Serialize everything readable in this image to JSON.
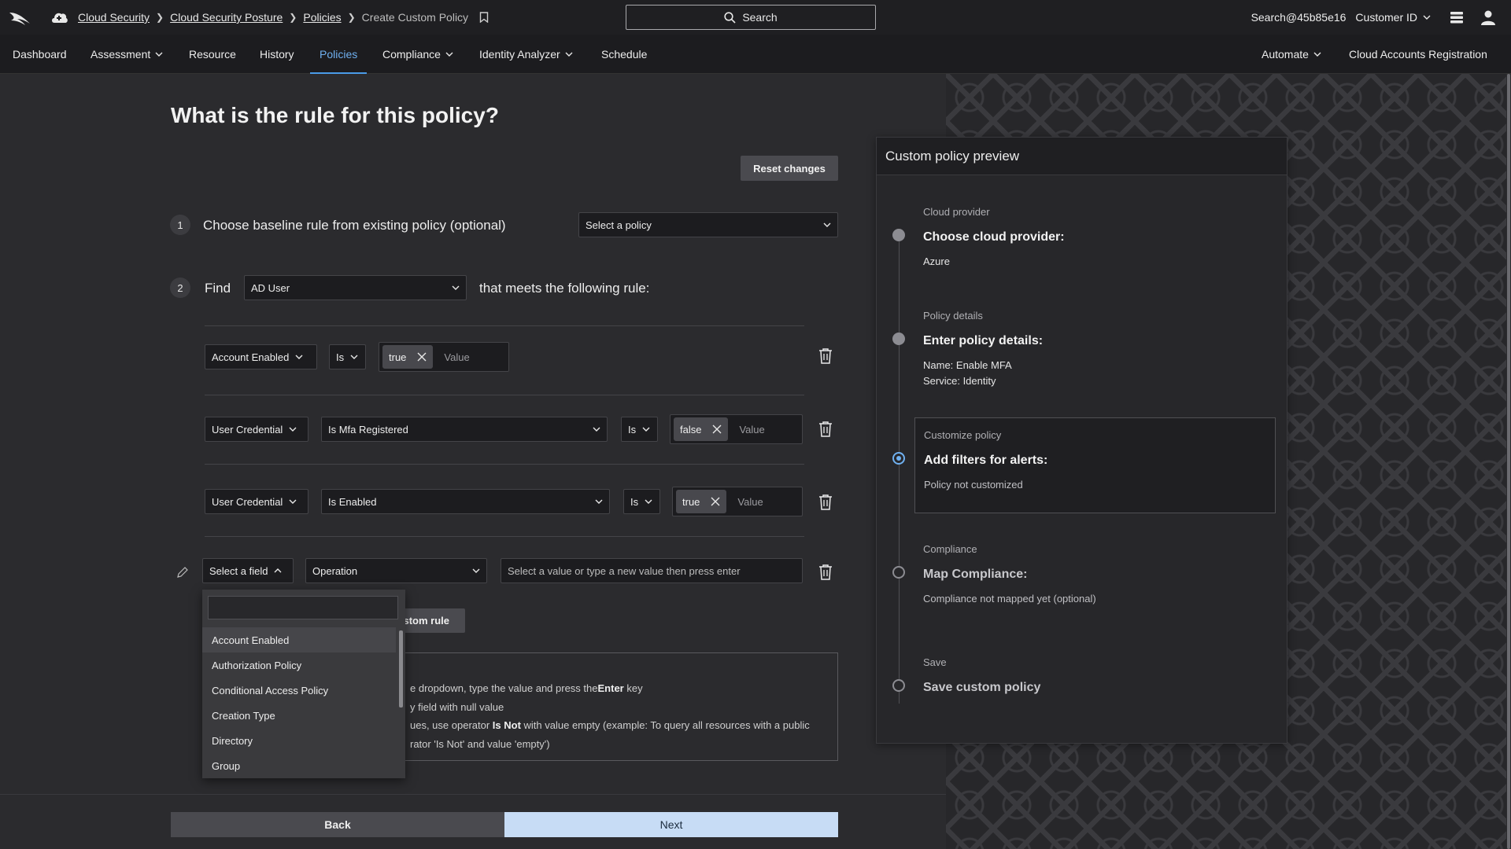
{
  "header": {
    "breadcrumbs": [
      "Cloud Security",
      "Cloud Security Posture",
      "Policies"
    ],
    "current_page": "Create Custom Policy",
    "search_label": "Search",
    "user": "Search@45b85e16",
    "customer_id_label": "Customer ID"
  },
  "nav": {
    "items": [
      {
        "label": "Dashboard"
      },
      {
        "label": "Assessment"
      },
      {
        "label": "Resource"
      },
      {
        "label": "History"
      },
      {
        "label": "Policies"
      },
      {
        "label": "Compliance"
      },
      {
        "label": "Identity Analyzer"
      },
      {
        "label": "Schedule"
      }
    ],
    "right_items": [
      {
        "label": "Automate"
      },
      {
        "label": "Cloud Accounts Registration"
      }
    ],
    "active": "Policies"
  },
  "main": {
    "title": "What is the rule for this policy?",
    "reset_label": "Reset changes",
    "step1": {
      "number": "1",
      "text": "Choose baseline rule from existing policy (optional)",
      "select_placeholder": "Select a policy"
    },
    "step2": {
      "number": "2",
      "find_label": "Find",
      "resource": "AD User",
      "suffix": "that meets the following rule:"
    },
    "rules": [
      {
        "field": "Account Enabled",
        "operator": "Is",
        "chip": "true",
        "value_placeholder": "Value"
      },
      {
        "field": "User Credential",
        "subfield": "Is Mfa Registered",
        "operator": "Is",
        "chip": "false",
        "value_placeholder": "Value"
      },
      {
        "field": "User Credential",
        "subfield": "Is Enabled",
        "operator": "Is",
        "chip": "true",
        "value_placeholder": "Value"
      }
    ],
    "new_rule": {
      "field_placeholder": "Select a field",
      "operation_placeholder": "Operation",
      "value_placeholder": "Select a value or type a new value then press enter"
    },
    "add_rule_label": "stom rule",
    "help": {
      "line1_pre": "e dropdown, type the value and press the",
      "line1_key": "Enter",
      "line1_post": " key",
      "line2": "y field with null value",
      "line3_pre": "ues, use operator ",
      "line3_op": "Is Not",
      "line3_post": " with value empty (example: To query all resources with a public",
      "line4": "rator 'Is Not' and value 'empty')"
    },
    "dropdown_options": [
      "Account Enabled",
      "Authorization Policy",
      "Conditional Access Policy",
      "Creation Type",
      "Directory",
      "Group"
    ],
    "back_label": "Back",
    "next_label": "Next"
  },
  "preview": {
    "title": "Custom policy preview",
    "steps": [
      {
        "label": "Cloud provider",
        "title": "Choose cloud provider:",
        "values": [
          "Azure"
        ]
      },
      {
        "label": "Policy details",
        "title": "Enter policy details:",
        "values": [
          "Name: Enable MFA",
          "Service: Identity"
        ]
      },
      {
        "label": "Customize policy",
        "title": "Add filters for alerts:",
        "values": [
          "Policy not customized"
        ]
      },
      {
        "label": "Compliance",
        "title": "Map Compliance:",
        "values": [
          "Compliance not mapped yet (optional)"
        ]
      },
      {
        "label": "Save",
        "title": "Save custom policy",
        "values": []
      }
    ]
  },
  "colors": {
    "accent": "#4a9be8",
    "next_button": "#c7dcf5",
    "background": "#2b2b2e"
  }
}
